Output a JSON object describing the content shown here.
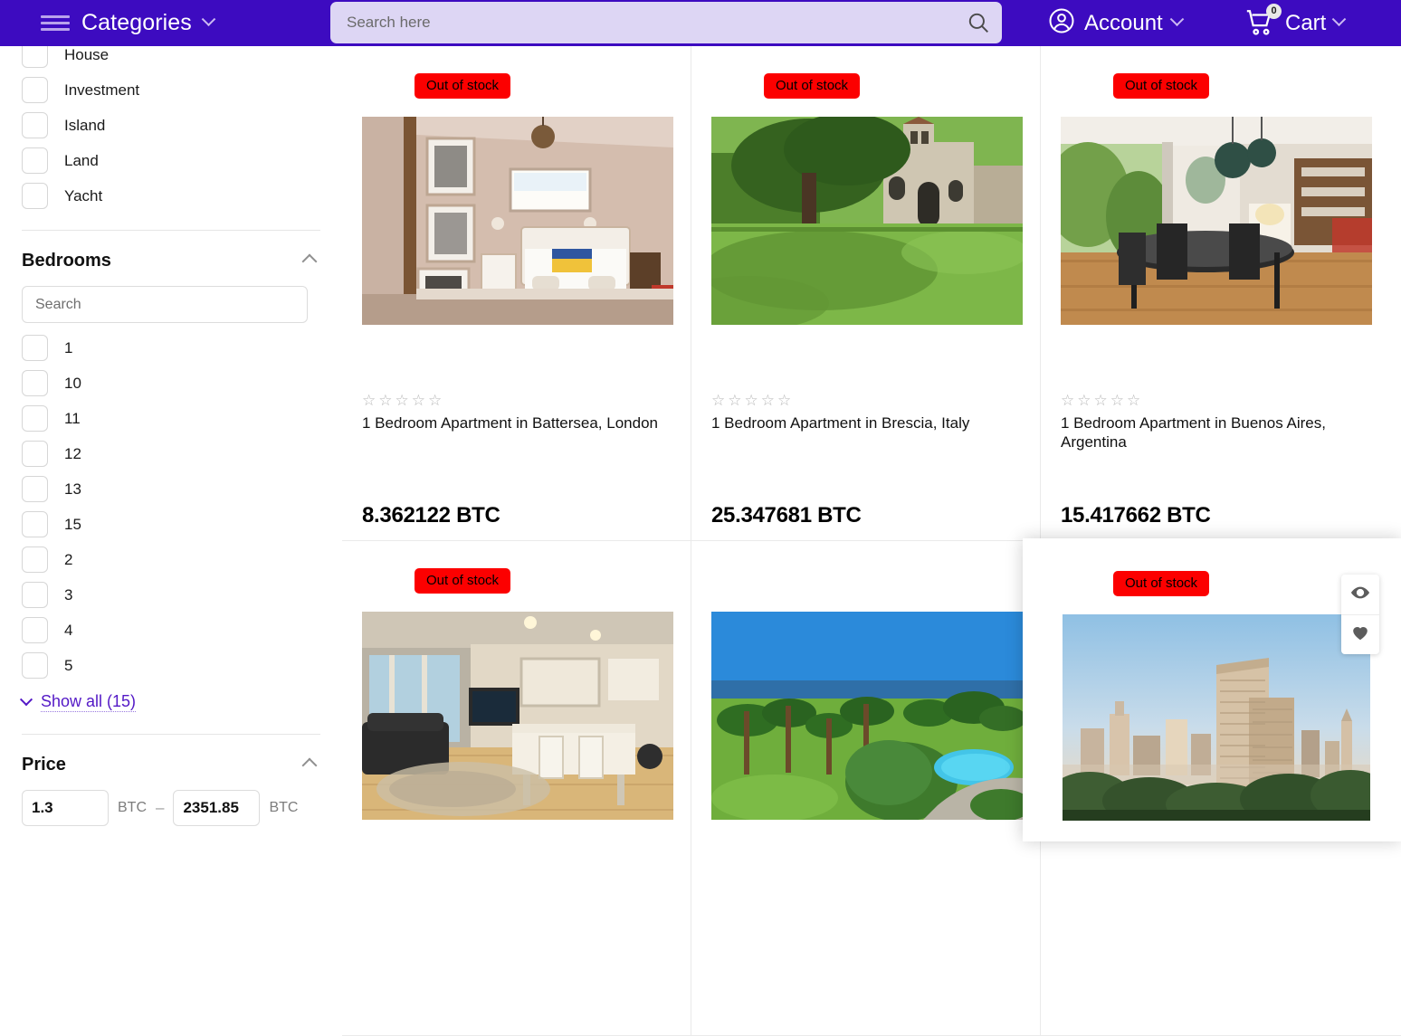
{
  "header": {
    "categories_label": "Categories",
    "menu_icon": "hamburger-icon",
    "chevron_icon": "chevron-down-icon",
    "search_placeholder": "Search here",
    "search_value": "",
    "search_icon": "search-icon",
    "account_label": "Account",
    "account_icon": "user-circle-icon",
    "cart_label": "Cart",
    "cart_icon": "shopping-cart-icon",
    "cart_count": "0",
    "brand_color": "#3d0bc0",
    "search_bg": "#ddd6f4"
  },
  "sidebar": {
    "category_items": [
      {
        "label": "House",
        "checked": false
      },
      {
        "label": "Investment",
        "checked": false
      },
      {
        "label": "Island",
        "checked": false
      },
      {
        "label": "Land",
        "checked": false
      },
      {
        "label": "Yacht",
        "checked": false
      }
    ],
    "bedrooms": {
      "title": "Bedrooms",
      "collapse_icon": "chevron-up-icon",
      "search_placeholder": "Search",
      "search_value": "",
      "options": [
        "1",
        "10",
        "11",
        "12",
        "13",
        "15",
        "2",
        "3",
        "4",
        "5"
      ],
      "show_all_label": "Show all (15)",
      "show_all_icon": "chevron-down-icon",
      "link_color": "#5318c6"
    },
    "price": {
      "title": "Price",
      "collapse_icon": "chevron-up-icon",
      "min_value": "1.3",
      "max_value": "2351.85",
      "min_unit": "BTC",
      "max_unit": "BTC",
      "separator": "–"
    }
  },
  "products": [
    {
      "badge": "Out of stock",
      "rating": "☆☆☆☆☆",
      "title": "1 Bedroom Apartment in Battersea, London",
      "price": "8.362122 BTC",
      "image": "bedroom-interior"
    },
    {
      "badge": "Out of stock",
      "rating": "☆☆☆☆☆",
      "title": "1 Bedroom Apartment in Brescia, Italy",
      "price": "25.347681 BTC",
      "image": "castle-lawn"
    },
    {
      "badge": "Out of stock",
      "rating": "☆☆☆☆☆",
      "title": "1 Bedroom Apartment in Buenos Aires, Argentina",
      "price": "15.417662 BTC",
      "image": "dining-room"
    },
    {
      "badge": "Out of stock",
      "rating": "",
      "title": "",
      "price": "",
      "image": "living-room"
    },
    {
      "badge": "",
      "rating": "",
      "title": "",
      "price": "",
      "image": "palm-garden-pool"
    },
    {
      "badge": "",
      "rating": "",
      "title": "",
      "price": "",
      "image": "city-tower"
    }
  ],
  "hover_card": {
    "badge": "Out of stock",
    "image": "city-tower",
    "actions": [
      {
        "name": "quick-view",
        "icon": "eye-icon"
      },
      {
        "name": "wishlist",
        "icon": "heart-icon"
      }
    ]
  }
}
